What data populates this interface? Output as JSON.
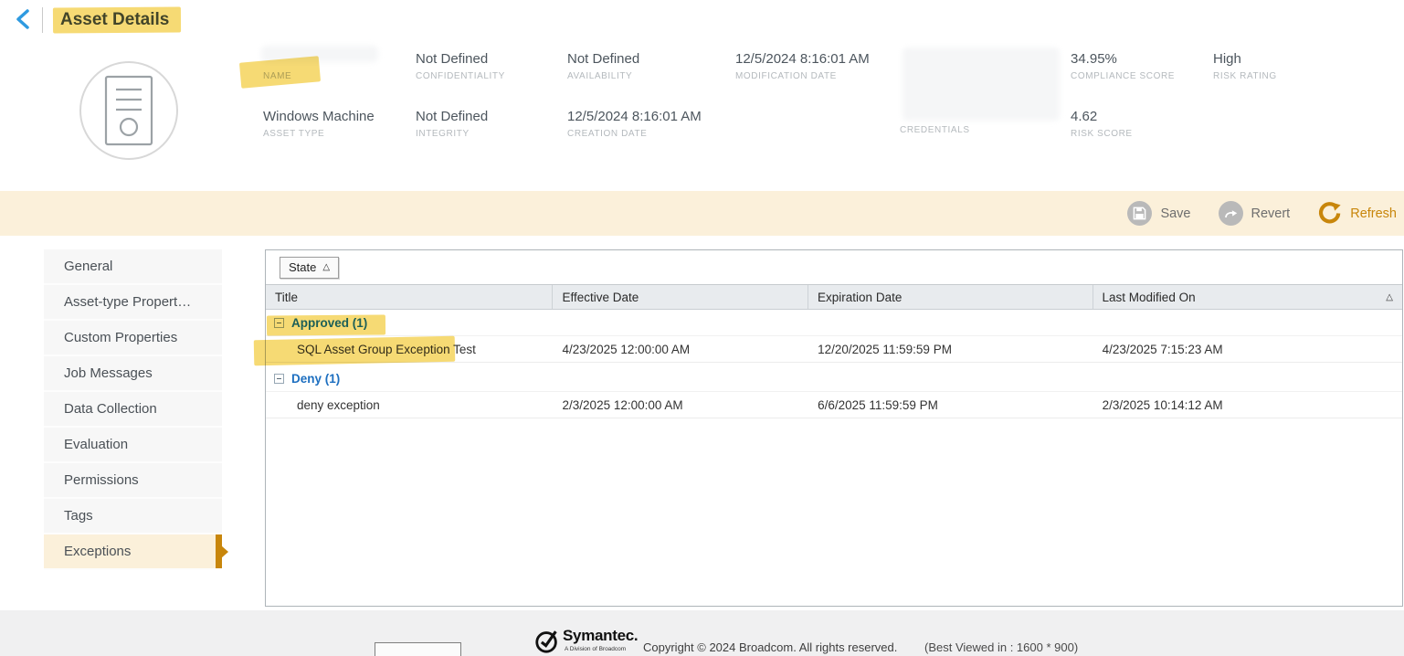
{
  "colors": {
    "accent": "#C8860B",
    "toolbar_bg": "#FBF0DA",
    "marker_highlight": "#F4D35C",
    "group_link_blue": "#1D6FC0",
    "back_chevron_blue": "#2E9AE0"
  },
  "header": {
    "title": "Asset Details",
    "summary": {
      "name": {
        "label": "NAME"
      },
      "asset_type": {
        "value": "Windows Machine",
        "label": "ASSET TYPE"
      },
      "confidentiality": {
        "value": "Not Defined",
        "label": "CONFIDENTIALITY"
      },
      "integrity": {
        "value": "Not Defined",
        "label": "INTEGRITY"
      },
      "availability": {
        "value": "Not Defined",
        "label": "AVAILABILITY"
      },
      "creation_date": {
        "value": "12/5/2024 8:16:01 AM",
        "label": "CREATION DATE"
      },
      "modification_date": {
        "value": "12/5/2024 8:16:01 AM",
        "label": "MODIFICATION DATE"
      },
      "credentials": {
        "label": "CREDENTIALS"
      },
      "compliance_score": {
        "value": "34.95%",
        "label": "COMPLIANCE SCORE"
      },
      "risk_score": {
        "value": "4.62",
        "label": "RISK SCORE"
      },
      "risk_rating": {
        "value": "High",
        "label": "RISK RATING"
      }
    }
  },
  "toolbar": {
    "save_label": "Save",
    "revert_label": "Revert",
    "refresh_label": "Refresh"
  },
  "sidebar": {
    "items": [
      "General",
      "Asset-type Propert…",
      "Custom Properties",
      "Job Messages",
      "Data Collection",
      "Evaluation",
      "Permissions",
      "Tags",
      "Exceptions"
    ],
    "active_item": "Exceptions"
  },
  "table": {
    "group_chip": "State",
    "sort_ascending_glyph": "△",
    "columns": [
      "Title",
      "Effective Date",
      "Expiration Date",
      "Last Modified On"
    ],
    "groups": [
      {
        "label": "Approved (1)",
        "rows": [
          {
            "title": "SQL Asset Group Exception Test",
            "effective_date": "4/23/2025 12:00:00 AM",
            "expiration_date": "12/20/2025 11:59:59 PM",
            "last_modified_on": "4/23/2025 7:15:23 AM"
          }
        ]
      },
      {
        "label": "Deny (1)",
        "rows": [
          {
            "title": "deny exception",
            "effective_date": "2/3/2025 12:00:00 AM",
            "expiration_date": "6/6/2025 11:59:59 PM",
            "last_modified_on": "2/3/2025 10:14:12 AM"
          }
        ]
      }
    ]
  },
  "footer": {
    "brand": "Symantec.",
    "brand_tagline": "A Division of Broadcom",
    "copyright": "Copyright © 2024 Broadcom. All rights reserved.",
    "best_viewed": "(Best Viewed in : 1600 * 900)"
  }
}
